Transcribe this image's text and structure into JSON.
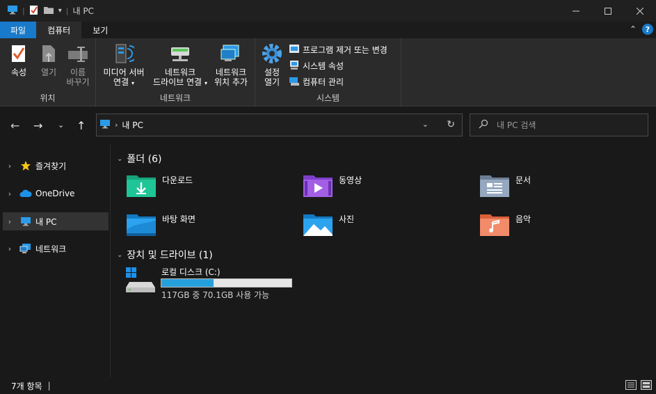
{
  "window": {
    "title": "내 PC",
    "quick_access_sep": "|",
    "title_sep": "|"
  },
  "tabs": [
    {
      "label": "파일"
    },
    {
      "label": "컴퓨터"
    },
    {
      "label": "보기"
    }
  ],
  "ribbon": {
    "groups": {
      "location": "위치",
      "network": "네트워크",
      "system": "시스템"
    },
    "buttons": {
      "properties": "속성",
      "open": "열기",
      "rename_1": "이름",
      "rename_2": "바꾸기",
      "media_1": "미디어 서버",
      "media_2": "연결",
      "map_1": "네트워크",
      "map_2": "드라이브 연결",
      "add_loc_1": "네트워크",
      "add_loc_2": "위치 추가",
      "settings_1": "설정",
      "settings_2": "열기",
      "uninstall": "프로그램 제거 또는 변경",
      "sys_props": "시스템 속성",
      "manage": "컴퓨터 관리"
    }
  },
  "address": {
    "path": "내 PC",
    "search_placeholder": "내 PC 검색"
  },
  "nav_pane": [
    {
      "label": "즐겨찾기"
    },
    {
      "label": "OneDrive"
    },
    {
      "label": "내 PC"
    },
    {
      "label": "네트워크"
    }
  ],
  "folders_section": "폴더 (6)",
  "folders": [
    {
      "name": "다운로드"
    },
    {
      "name": "동영상"
    },
    {
      "name": "문서"
    },
    {
      "name": "바탕 화면"
    },
    {
      "name": "사진"
    },
    {
      "name": "음악"
    }
  ],
  "devices_section": "장치 및 드라이브 (1)",
  "drive": {
    "name": "로컬 디스크 (C:)",
    "size_text": "117GB 중 70.1GB 사용 가능",
    "used_fraction": 0.401
  },
  "status": {
    "count": "7개 항목",
    "pipe": "|"
  },
  "colors": {
    "accent": "#1979ca",
    "bar_fill": "#26a0da"
  }
}
